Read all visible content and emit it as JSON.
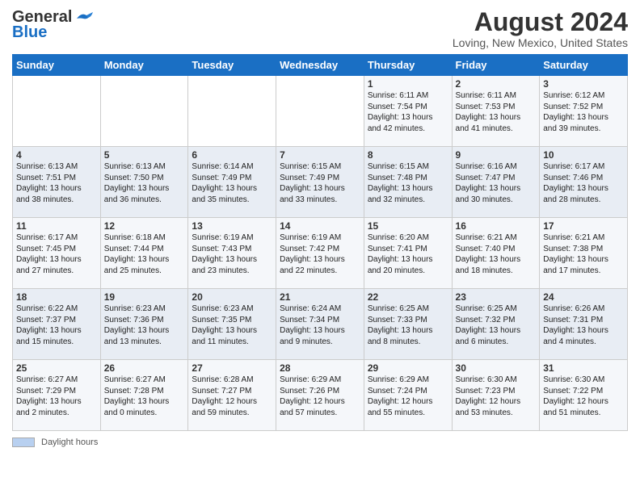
{
  "header": {
    "logo_line1": "General",
    "logo_line2": "Blue",
    "title": "August 2024",
    "subtitle": "Loving, New Mexico, United States"
  },
  "weekdays": [
    "Sunday",
    "Monday",
    "Tuesday",
    "Wednesday",
    "Thursday",
    "Friday",
    "Saturday"
  ],
  "weeks": [
    [
      {
        "day": "",
        "info": ""
      },
      {
        "day": "",
        "info": ""
      },
      {
        "day": "",
        "info": ""
      },
      {
        "day": "",
        "info": ""
      },
      {
        "day": "1",
        "info": "Sunrise: 6:11 AM\nSunset: 7:54 PM\nDaylight: 13 hours\nand 42 minutes."
      },
      {
        "day": "2",
        "info": "Sunrise: 6:11 AM\nSunset: 7:53 PM\nDaylight: 13 hours\nand 41 minutes."
      },
      {
        "day": "3",
        "info": "Sunrise: 6:12 AM\nSunset: 7:52 PM\nDaylight: 13 hours\nand 39 minutes."
      }
    ],
    [
      {
        "day": "4",
        "info": "Sunrise: 6:13 AM\nSunset: 7:51 PM\nDaylight: 13 hours\nand 38 minutes."
      },
      {
        "day": "5",
        "info": "Sunrise: 6:13 AM\nSunset: 7:50 PM\nDaylight: 13 hours\nand 36 minutes."
      },
      {
        "day": "6",
        "info": "Sunrise: 6:14 AM\nSunset: 7:49 PM\nDaylight: 13 hours\nand 35 minutes."
      },
      {
        "day": "7",
        "info": "Sunrise: 6:15 AM\nSunset: 7:49 PM\nDaylight: 13 hours\nand 33 minutes."
      },
      {
        "day": "8",
        "info": "Sunrise: 6:15 AM\nSunset: 7:48 PM\nDaylight: 13 hours\nand 32 minutes."
      },
      {
        "day": "9",
        "info": "Sunrise: 6:16 AM\nSunset: 7:47 PM\nDaylight: 13 hours\nand 30 minutes."
      },
      {
        "day": "10",
        "info": "Sunrise: 6:17 AM\nSunset: 7:46 PM\nDaylight: 13 hours\nand 28 minutes."
      }
    ],
    [
      {
        "day": "11",
        "info": "Sunrise: 6:17 AM\nSunset: 7:45 PM\nDaylight: 13 hours\nand 27 minutes."
      },
      {
        "day": "12",
        "info": "Sunrise: 6:18 AM\nSunset: 7:44 PM\nDaylight: 13 hours\nand 25 minutes."
      },
      {
        "day": "13",
        "info": "Sunrise: 6:19 AM\nSunset: 7:43 PM\nDaylight: 13 hours\nand 23 minutes."
      },
      {
        "day": "14",
        "info": "Sunrise: 6:19 AM\nSunset: 7:42 PM\nDaylight: 13 hours\nand 22 minutes."
      },
      {
        "day": "15",
        "info": "Sunrise: 6:20 AM\nSunset: 7:41 PM\nDaylight: 13 hours\nand 20 minutes."
      },
      {
        "day": "16",
        "info": "Sunrise: 6:21 AM\nSunset: 7:40 PM\nDaylight: 13 hours\nand 18 minutes."
      },
      {
        "day": "17",
        "info": "Sunrise: 6:21 AM\nSunset: 7:38 PM\nDaylight: 13 hours\nand 17 minutes."
      }
    ],
    [
      {
        "day": "18",
        "info": "Sunrise: 6:22 AM\nSunset: 7:37 PM\nDaylight: 13 hours\nand 15 minutes."
      },
      {
        "day": "19",
        "info": "Sunrise: 6:23 AM\nSunset: 7:36 PM\nDaylight: 13 hours\nand 13 minutes."
      },
      {
        "day": "20",
        "info": "Sunrise: 6:23 AM\nSunset: 7:35 PM\nDaylight: 13 hours\nand 11 minutes."
      },
      {
        "day": "21",
        "info": "Sunrise: 6:24 AM\nSunset: 7:34 PM\nDaylight: 13 hours\nand 9 minutes."
      },
      {
        "day": "22",
        "info": "Sunrise: 6:25 AM\nSunset: 7:33 PM\nDaylight: 13 hours\nand 8 minutes."
      },
      {
        "day": "23",
        "info": "Sunrise: 6:25 AM\nSunset: 7:32 PM\nDaylight: 13 hours\nand 6 minutes."
      },
      {
        "day": "24",
        "info": "Sunrise: 6:26 AM\nSunset: 7:31 PM\nDaylight: 13 hours\nand 4 minutes."
      }
    ],
    [
      {
        "day": "25",
        "info": "Sunrise: 6:27 AM\nSunset: 7:29 PM\nDaylight: 13 hours\nand 2 minutes."
      },
      {
        "day": "26",
        "info": "Sunrise: 6:27 AM\nSunset: 7:28 PM\nDaylight: 13 hours\nand 0 minutes."
      },
      {
        "day": "27",
        "info": "Sunrise: 6:28 AM\nSunset: 7:27 PM\nDaylight: 12 hours\nand 59 minutes."
      },
      {
        "day": "28",
        "info": "Sunrise: 6:29 AM\nSunset: 7:26 PM\nDaylight: 12 hours\nand 57 minutes."
      },
      {
        "day": "29",
        "info": "Sunrise: 6:29 AM\nSunset: 7:24 PM\nDaylight: 12 hours\nand 55 minutes."
      },
      {
        "day": "30",
        "info": "Sunrise: 6:30 AM\nSunset: 7:23 PM\nDaylight: 12 hours\nand 53 minutes."
      },
      {
        "day": "31",
        "info": "Sunrise: 6:30 AM\nSunset: 7:22 PM\nDaylight: 12 hours\nand 51 minutes."
      }
    ]
  ],
  "footer": {
    "legend_label": "Daylight hours"
  }
}
